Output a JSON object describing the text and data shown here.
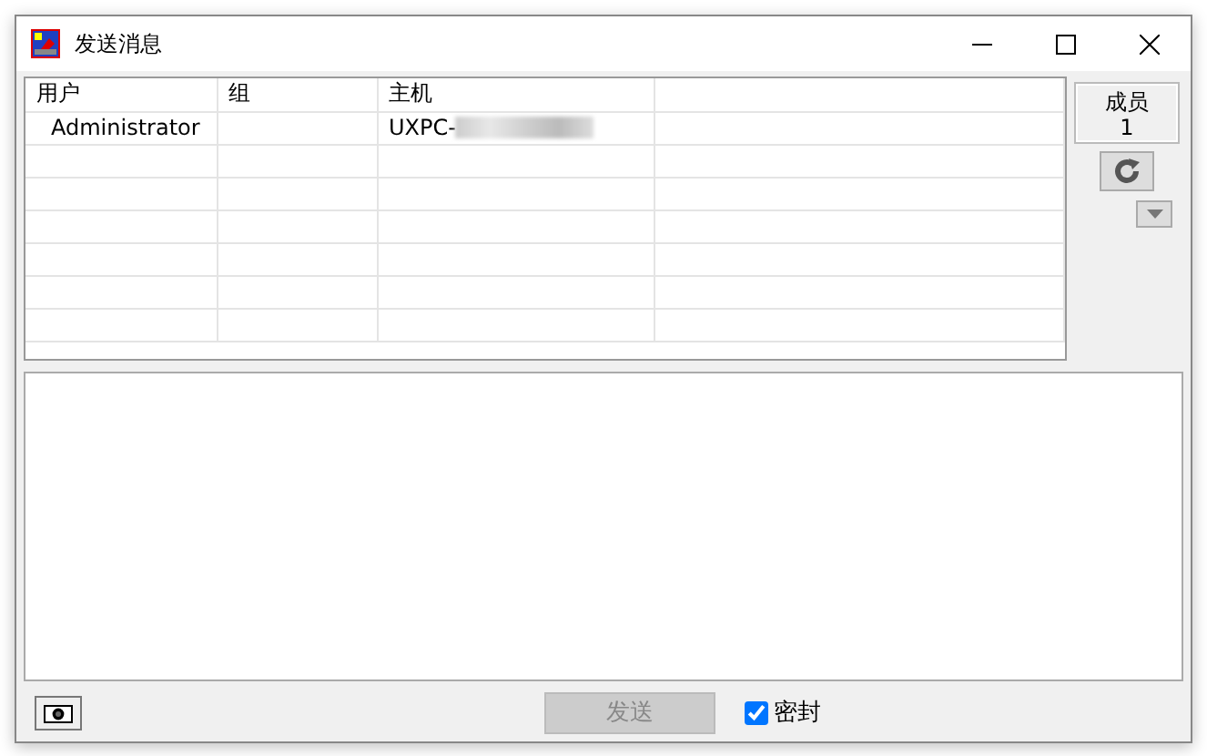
{
  "window": {
    "title": "发送消息"
  },
  "table": {
    "columns": [
      "用户",
      "组",
      "主机"
    ],
    "rows": [
      {
        "cells": [
          "Administrator",
          "",
          "UXPC-"
        ],
        "host_redacted": true
      }
    ]
  },
  "members": {
    "label": "成员",
    "count": "1"
  },
  "send_button": {
    "label": "发送",
    "disabled": true
  },
  "seal": {
    "label": "密封",
    "checked": true
  }
}
